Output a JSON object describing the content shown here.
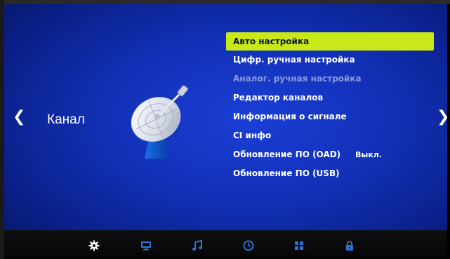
{
  "nav": {
    "left_arrow": "❮",
    "right_arrow": "❯"
  },
  "section": {
    "title": "Канал"
  },
  "menu": {
    "items": [
      {
        "label": "Авто настройка",
        "state": "selected"
      },
      {
        "label": "Цифр. ручная настройка",
        "state": "normal"
      },
      {
        "label": "Аналог. ручная настройка",
        "state": "disabled"
      },
      {
        "label": "Редактор каналов",
        "state": "normal"
      },
      {
        "label": "Информация о сигнале",
        "state": "normal"
      },
      {
        "label": "CI инфо",
        "state": "normal"
      },
      {
        "label": "Обновление ПО (OAD)",
        "state": "normal",
        "value": "Выкл."
      },
      {
        "label": "Обновление ПО (USB)",
        "state": "normal"
      }
    ]
  },
  "tabs": [
    {
      "icon": "gear-icon",
      "active": true
    },
    {
      "icon": "monitor-icon",
      "active": false
    },
    {
      "icon": "music-note-icon",
      "active": false
    },
    {
      "icon": "clock-icon",
      "active": false
    },
    {
      "icon": "grid-icon",
      "active": false
    },
    {
      "icon": "lock-icon",
      "active": false
    }
  ],
  "colors": {
    "selected_bg": "#c9e81a",
    "background": "#1231b8",
    "disabled_text": "#8a9ad8"
  }
}
